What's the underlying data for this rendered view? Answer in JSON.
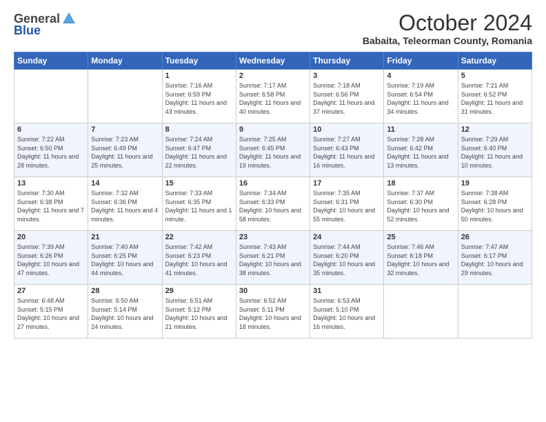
{
  "header": {
    "logo_general": "General",
    "logo_blue": "Blue",
    "title": "October 2024",
    "location": "Babaita, Teleorman County, Romania"
  },
  "days_of_week": [
    "Sunday",
    "Monday",
    "Tuesday",
    "Wednesday",
    "Thursday",
    "Friday",
    "Saturday"
  ],
  "weeks": [
    [
      {
        "day": "",
        "info": ""
      },
      {
        "day": "",
        "info": ""
      },
      {
        "day": "1",
        "info": "Sunrise: 7:16 AM\nSunset: 6:59 PM\nDaylight: 11 hours and 43 minutes."
      },
      {
        "day": "2",
        "info": "Sunrise: 7:17 AM\nSunset: 6:58 PM\nDaylight: 11 hours and 40 minutes."
      },
      {
        "day": "3",
        "info": "Sunrise: 7:18 AM\nSunset: 6:56 PM\nDaylight: 11 hours and 37 minutes."
      },
      {
        "day": "4",
        "info": "Sunrise: 7:19 AM\nSunset: 6:54 PM\nDaylight: 11 hours and 34 minutes."
      },
      {
        "day": "5",
        "info": "Sunrise: 7:21 AM\nSunset: 6:52 PM\nDaylight: 11 hours and 31 minutes."
      }
    ],
    [
      {
        "day": "6",
        "info": "Sunrise: 7:22 AM\nSunset: 6:50 PM\nDaylight: 11 hours and 28 minutes."
      },
      {
        "day": "7",
        "info": "Sunrise: 7:23 AM\nSunset: 6:49 PM\nDaylight: 11 hours and 25 minutes."
      },
      {
        "day": "8",
        "info": "Sunrise: 7:24 AM\nSunset: 6:47 PM\nDaylight: 11 hours and 22 minutes."
      },
      {
        "day": "9",
        "info": "Sunrise: 7:25 AM\nSunset: 6:45 PM\nDaylight: 11 hours and 19 minutes."
      },
      {
        "day": "10",
        "info": "Sunrise: 7:27 AM\nSunset: 6:43 PM\nDaylight: 11 hours and 16 minutes."
      },
      {
        "day": "11",
        "info": "Sunrise: 7:28 AM\nSunset: 6:42 PM\nDaylight: 11 hours and 13 minutes."
      },
      {
        "day": "12",
        "info": "Sunrise: 7:29 AM\nSunset: 6:40 PM\nDaylight: 11 hours and 10 minutes."
      }
    ],
    [
      {
        "day": "13",
        "info": "Sunrise: 7:30 AM\nSunset: 6:38 PM\nDaylight: 11 hours and 7 minutes."
      },
      {
        "day": "14",
        "info": "Sunrise: 7:32 AM\nSunset: 6:36 PM\nDaylight: 11 hours and 4 minutes."
      },
      {
        "day": "15",
        "info": "Sunrise: 7:33 AM\nSunset: 6:35 PM\nDaylight: 11 hours and 1 minute."
      },
      {
        "day": "16",
        "info": "Sunrise: 7:34 AM\nSunset: 6:33 PM\nDaylight: 10 hours and 58 minutes."
      },
      {
        "day": "17",
        "info": "Sunrise: 7:35 AM\nSunset: 6:31 PM\nDaylight: 10 hours and 55 minutes."
      },
      {
        "day": "18",
        "info": "Sunrise: 7:37 AM\nSunset: 6:30 PM\nDaylight: 10 hours and 52 minutes."
      },
      {
        "day": "19",
        "info": "Sunrise: 7:38 AM\nSunset: 6:28 PM\nDaylight: 10 hours and 50 minutes."
      }
    ],
    [
      {
        "day": "20",
        "info": "Sunrise: 7:39 AM\nSunset: 6:26 PM\nDaylight: 10 hours and 47 minutes."
      },
      {
        "day": "21",
        "info": "Sunrise: 7:40 AM\nSunset: 6:25 PM\nDaylight: 10 hours and 44 minutes."
      },
      {
        "day": "22",
        "info": "Sunrise: 7:42 AM\nSunset: 6:23 PM\nDaylight: 10 hours and 41 minutes."
      },
      {
        "day": "23",
        "info": "Sunrise: 7:43 AM\nSunset: 6:21 PM\nDaylight: 10 hours and 38 minutes."
      },
      {
        "day": "24",
        "info": "Sunrise: 7:44 AM\nSunset: 6:20 PM\nDaylight: 10 hours and 35 minutes."
      },
      {
        "day": "25",
        "info": "Sunrise: 7:46 AM\nSunset: 6:18 PM\nDaylight: 10 hours and 32 minutes."
      },
      {
        "day": "26",
        "info": "Sunrise: 7:47 AM\nSunset: 6:17 PM\nDaylight: 10 hours and 29 minutes."
      }
    ],
    [
      {
        "day": "27",
        "info": "Sunrise: 6:48 AM\nSunset: 5:15 PM\nDaylight: 10 hours and 27 minutes."
      },
      {
        "day": "28",
        "info": "Sunrise: 6:50 AM\nSunset: 5:14 PM\nDaylight: 10 hours and 24 minutes."
      },
      {
        "day": "29",
        "info": "Sunrise: 6:51 AM\nSunset: 5:12 PM\nDaylight: 10 hours and 21 minutes."
      },
      {
        "day": "30",
        "info": "Sunrise: 6:52 AM\nSunset: 5:11 PM\nDaylight: 10 hours and 18 minutes."
      },
      {
        "day": "31",
        "info": "Sunrise: 6:53 AM\nSunset: 5:10 PM\nDaylight: 10 hours and 16 minutes."
      },
      {
        "day": "",
        "info": ""
      },
      {
        "day": "",
        "info": ""
      }
    ]
  ]
}
